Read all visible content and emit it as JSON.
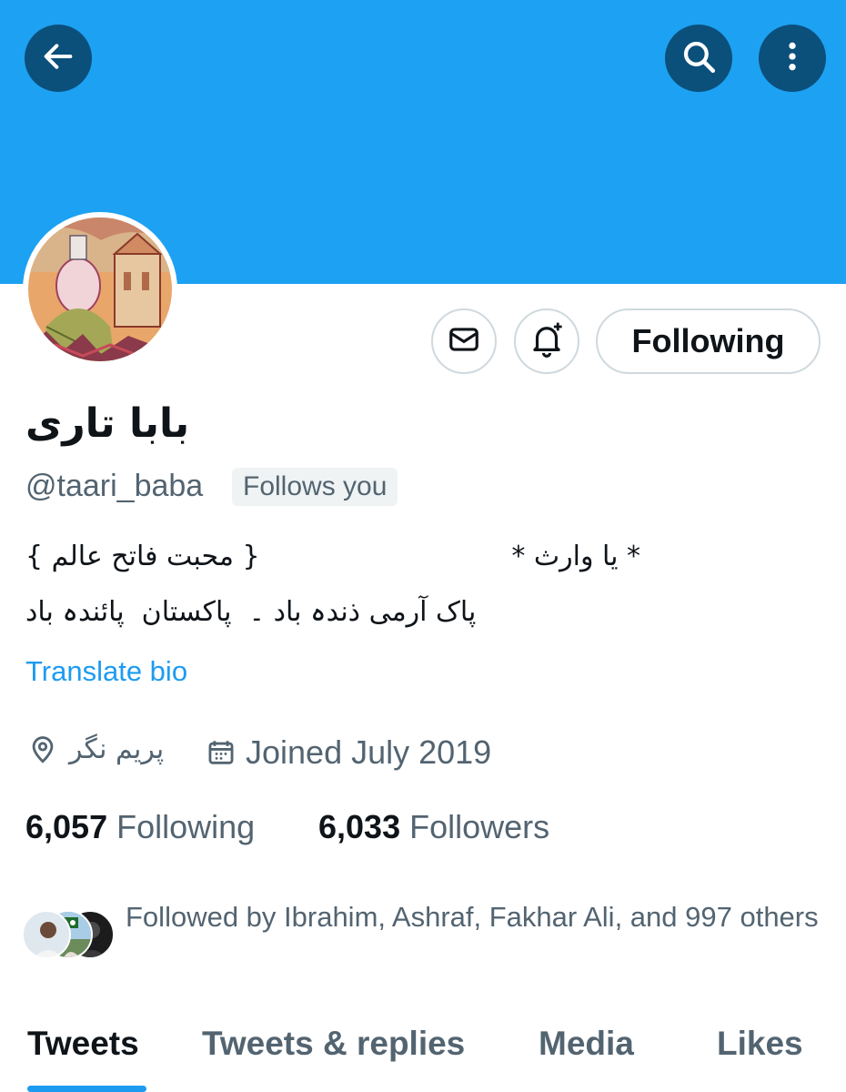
{
  "header": {
    "back_icon": "arrow-left-icon",
    "search_icon": "search-icon",
    "more_icon": "more-vertical-icon"
  },
  "colors": {
    "banner": "#1da1f2",
    "accent": "#1d9bf0",
    "icon_button_bg": "#0b4f7b"
  },
  "profile": {
    "display_name": "بابا تاری",
    "handle": "@taari_baba",
    "follows_you_badge": "Follows you",
    "actions": {
      "message_icon": "mail-icon",
      "notify_icon": "bell-plus-icon",
      "following_label": "Following"
    },
    "bio": {
      "line1_right": "* یا وارث *",
      "line1_left": "{ محبت فاتح عالم }",
      "line2": "پاک آرمی ذندہ باد ۔  پاکستان  پائندہ باد"
    },
    "translate_label": "Translate bio",
    "location": "پریم نگر",
    "joined": "Joined July 2019",
    "following_count": "6,057",
    "following_label": "Following",
    "followers_count": "6,033",
    "followers_label": "Followers",
    "followed_by": "Followed by Ibrahim, Ashraf, Fakhar Ali, and 997 others"
  },
  "tabs": [
    {
      "label": "Tweets",
      "active": true
    },
    {
      "label": "Tweets & replies",
      "active": false
    },
    {
      "label": "Media",
      "active": false
    },
    {
      "label": "Likes",
      "active": false
    }
  ]
}
